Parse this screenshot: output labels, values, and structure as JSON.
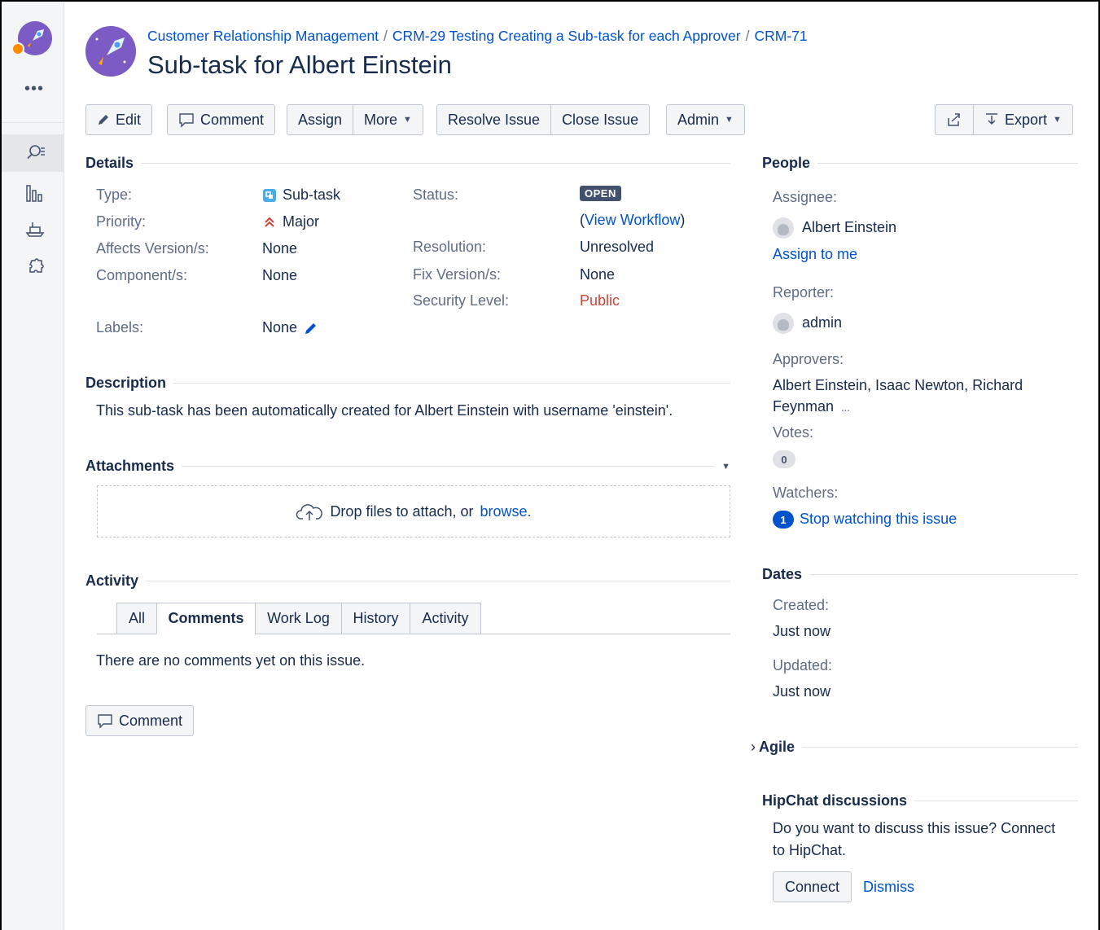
{
  "breadcrumb": {
    "project": "Customer Relationship Management",
    "parent": "CRM-29 Testing Creating a Sub-task for each Approver",
    "key": "CRM-71",
    "separator": "/"
  },
  "issue_title": "Sub-task for Albert Einstein",
  "sidebar": {
    "more": "•••"
  },
  "toolbar": {
    "edit": "Edit",
    "comment": "Comment",
    "assign": "Assign",
    "more": "More",
    "resolve": "Resolve Issue",
    "close": "Close Issue",
    "admin": "Admin",
    "export": "Export"
  },
  "details": {
    "heading": "Details",
    "type_label": "Type:",
    "type_value": "Sub-task",
    "priority_label": "Priority:",
    "priority_value": "Major",
    "affects_label": "Affects Version/s:",
    "affects_value": "None",
    "component_label": "Component/s:",
    "component_value": "None",
    "labels_label": "Labels:",
    "labels_value": "None",
    "status_label": "Status:",
    "status_value": "OPEN",
    "view_workflow": "View Workflow",
    "open_paren": "(",
    "close_paren": ")",
    "resolution_label": "Resolution:",
    "resolution_value": "Unresolved",
    "fix_label": "Fix Version/s:",
    "fix_value": "None",
    "security_label": "Security Level:",
    "security_value": "Public"
  },
  "description": {
    "heading": "Description",
    "text": "This sub-task has been automatically created for Albert Einstein with username 'einstein'."
  },
  "attachments": {
    "heading": "Attachments",
    "drop_text": "Drop files to attach, or",
    "browse": "browse."
  },
  "activity": {
    "heading": "Activity",
    "tabs": [
      "All",
      "Comments",
      "Work Log",
      "History",
      "Activity"
    ],
    "empty": "There are no comments yet on this issue.",
    "comment_button": "Comment"
  },
  "people": {
    "heading": "People",
    "assignee_label": "Assignee:",
    "assignee": "Albert Einstein",
    "assign_to_me": "Assign to me",
    "reporter_label": "Reporter:",
    "reporter": "admin",
    "approvers_label": "Approvers:",
    "approvers_line1": "Albert Einstein, Isaac Newton, Richard",
    "approvers_line2": "Feynman",
    "approvers_more": "...",
    "votes_label": "Votes:",
    "votes": "0",
    "watchers_label": "Watchers:",
    "watchers_count": "1",
    "stop_watching": "Stop watching this issue"
  },
  "dates": {
    "heading": "Dates",
    "created_label": "Created:",
    "created": "Just now",
    "updated_label": "Updated:",
    "updated": "Just now"
  },
  "agile": {
    "heading": "Agile",
    "chevron": "›"
  },
  "hipchat": {
    "heading": "HipChat discussions",
    "line1": "Do you want to discuss this issue? Connect",
    "line2": "to HipChat.",
    "connect": "Connect",
    "dismiss": "Dismiss"
  },
  "colors": {
    "link": "#0052cc",
    "priority_major": "#d04437",
    "security_public": "#d04437",
    "lozenge": "#42526e",
    "avatar_purple": "#7c5cc4"
  }
}
